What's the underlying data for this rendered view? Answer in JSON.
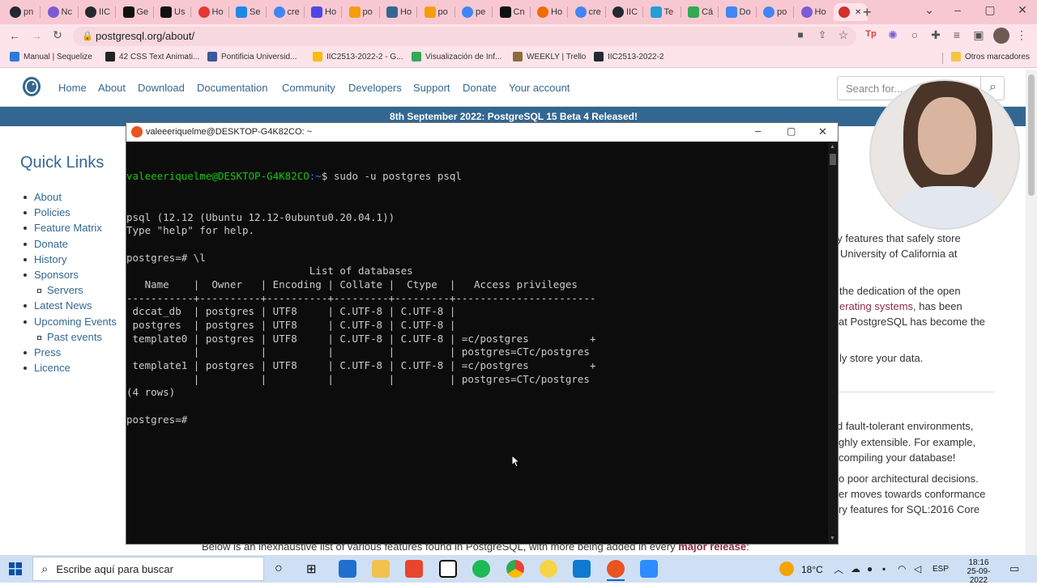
{
  "browser": {
    "tabs": [
      {
        "label": "pn",
        "icon": "github-icon",
        "color": "#24292f"
      },
      {
        "label": "Nc",
        "icon": "gear-icon",
        "color": "#7b5bd6"
      },
      {
        "label": "IIC",
        "icon": "github-icon",
        "color": "#24292f"
      },
      {
        "label": "Ge",
        "icon": "dev-icon",
        "color": "#111111"
      },
      {
        "label": "Us",
        "icon": "app-icon",
        "color": "#111111"
      },
      {
        "label": "Ho",
        "icon": "record-icon",
        "color": "#e53935"
      },
      {
        "label": "Se",
        "icon": "box-icon",
        "color": "#1e88e5"
      },
      {
        "label": "cre",
        "icon": "google-icon",
        "color": "#4285f4"
      },
      {
        "label": "Ho",
        "icon": "u-icon",
        "color": "#4f46e5"
      },
      {
        "label": "po",
        "icon": "flame-icon",
        "color": "#f59e0b"
      },
      {
        "label": "Ho",
        "icon": "globe-icon",
        "color": "#336791"
      },
      {
        "label": "po",
        "icon": "flame-icon",
        "color": "#f59e0b"
      },
      {
        "label": "pe",
        "icon": "google-icon",
        "color": "#4285f4"
      },
      {
        "label": "Cn",
        "icon": "app-icon",
        "color": "#111111"
      },
      {
        "label": "Ho",
        "icon": "record-icon",
        "color": "#ef6c00"
      },
      {
        "label": "cre",
        "icon": "google-icon",
        "color": "#4285f4"
      },
      {
        "label": "IIC",
        "icon": "github-icon",
        "color": "#24292f"
      },
      {
        "label": "Te",
        "icon": "telegram-icon",
        "color": "#229ed9"
      },
      {
        "label": "Cá",
        "icon": "drive-icon",
        "color": "#34a853"
      },
      {
        "label": "Do",
        "icon": "docs-icon",
        "color": "#4285f4"
      },
      {
        "label": "po",
        "icon": "google-icon",
        "color": "#4285f4"
      },
      {
        "label": "Ho",
        "icon": "gear-icon",
        "color": "#7b5bd6"
      },
      {
        "label": "",
        "icon": "record-icon",
        "color": "#d32f2f"
      }
    ],
    "new_tab": "+",
    "url": "postgresql.org/about/",
    "bookmarks": [
      {
        "label": "Manual | Sequelize",
        "color": "#2b7bd6"
      },
      {
        "label": "42 CSS Text Animati...",
        "color": "#222222"
      },
      {
        "label": "Pontificia Universid...",
        "color": "#3b5998"
      },
      {
        "label": "IIC2513-2022-2 - G...",
        "color": "#fbbc04"
      },
      {
        "label": "Visualización de Inf...",
        "color": "#34a853"
      },
      {
        "label": "WEEKLY | Trello",
        "color": "#8a6d3b"
      },
      {
        "label": "IIC2513-2022-2",
        "color": "#24292f"
      }
    ],
    "other_bookmarks": "Otros marcadores"
  },
  "site": {
    "nav": [
      "Home",
      "About",
      "Download",
      "Documentation",
      "Community",
      "Developers",
      "Support",
      "Donate",
      "Your account"
    ],
    "search_placeholder": "Search for...",
    "banner": "8th September 2022: PostgreSQL 15 Beta 4 Released!",
    "quick_links_title": "Quick Links",
    "quick_links": [
      "About",
      "Policies",
      "Feature Matrix",
      "Donate",
      "History",
      "Sponsors",
      "Servers",
      "Latest News",
      "Upcoming Events",
      "Past events",
      "Press",
      "Licence"
    ],
    "right_fragments": [
      "ny features that safely store",
      "University of California at",
      "the dedication of the open",
      "erating systems",
      ", has been",
      "at PostgreSQL has become the",
      "ly store your data.",
      "d fault-tolerant environments,",
      "ghly extensible. For example,",
      "compiling your database!",
      "o poor architectural decisions.",
      "er moves towards conformance",
      "ry features for SQL:2016 Core"
    ],
    "bottom_text": "Below is an inexhaustive list of various features found in PostgreSQL, with more being added in every",
    "bottom_link": "major release"
  },
  "terminal": {
    "title": "valeeeriquelme@DESKTOP-G4K82CO: ~",
    "prompt_user": "valeeeriquelme@DESKTOP-G4K82CO",
    "prompt_path": ":~",
    "command": "$ sudo -u postgres psql",
    "lines": [
      "psql (12.12 (Ubuntu 12.12-0ubuntu0.20.04.1))",
      "Type \"help\" for help.",
      "",
      "postgres=# \\l",
      "                              List of databases",
      "   Name    |  Owner   | Encoding | Collate |  Ctype  |   Access privileges",
      "-----------+----------+----------+---------+---------+-----------------------",
      " dccat_db  | postgres | UTF8     | C.UTF-8 | C.UTF-8 |",
      " postgres  | postgres | UTF8     | C.UTF-8 | C.UTF-8 |",
      " template0 | postgres | UTF8     | C.UTF-8 | C.UTF-8 | =c/postgres          +",
      "           |          |          |         |         | postgres=CTc/postgres",
      " template1 | postgres | UTF8     | C.UTF-8 | C.UTF-8 | =c/postgres          +",
      "           |          |          |         |         | postgres=CTc/postgres",
      "(4 rows)",
      "",
      "postgres=#"
    ]
  },
  "taskbar": {
    "search_placeholder": "Escribe aquí para buscar",
    "weather": "18°C",
    "language": "ESP",
    "time": "18:16",
    "date": "25-09-2022"
  }
}
